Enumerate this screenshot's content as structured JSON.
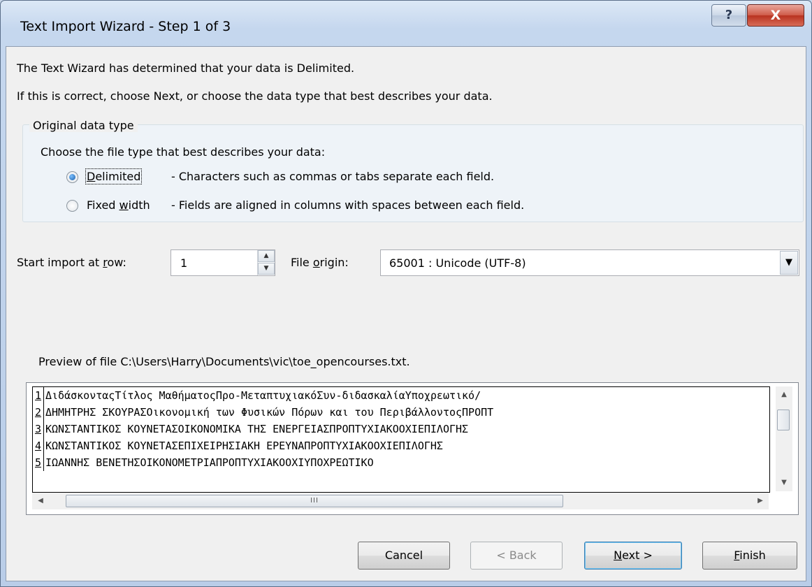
{
  "window": {
    "title": "Text Import Wizard - Step 1 of 3",
    "help_label": "?",
    "close_label": "X"
  },
  "intro": {
    "line1": "The Text Wizard has determined that your data is Delimited.",
    "line2": "If this is correct, choose Next, or choose the data type that best describes your data."
  },
  "data_type": {
    "legend": "Original data type",
    "prompt": "Choose the file type that best describes your data:",
    "options": [
      {
        "label": "Delimited",
        "accel": "D",
        "rest": "elimited",
        "description": "- Characters such as commas or tabs separate each field.",
        "selected": true
      },
      {
        "label": "Fixed width",
        "pre": "Fixed ",
        "accel": "w",
        "rest": "idth",
        "description": "- Fields are aligned in columns with spaces between each field.",
        "selected": false
      }
    ]
  },
  "start_row": {
    "label_pre": "Start import at ",
    "label_accel": "r",
    "label_post": "ow:",
    "value": "1"
  },
  "file_origin": {
    "label_pre": "File ",
    "label_accel": "o",
    "label_post": "rigin:",
    "value": "65001 : Unicode (UTF-8)"
  },
  "preview": {
    "label": "Preview of file C:\\Users\\Harry\\Documents\\vic\\toe_opencourses.txt.",
    "lines": [
      {
        "num": "1",
        "text": "ΔιδάσκονταςΤίτλος ΜαθήματοςΠρο-ΜεταπτυχιακόΣυν-διδασκαλίαΥποχρεωτικό/"
      },
      {
        "num": "2",
        "text": "ΔΗΜΗΤΡΗΣ ΣΚΟΥΡΑΣΟικονομική των Φυσικών Πόρων και του ΠεριβάλλοντοςΠΡΟΠΤ"
      },
      {
        "num": "3",
        "text": "ΚΩΝΣΤΑΝΤΙΚΟΣ ΚΟΥΝΕΤΑΣΟΙΚΟΝΟΜΙΚΑ ΤΗΣ ΕΝΕΡΓΕΙΑΣΠΡΟΠΤΥΧΙΑΚΟΟΧΙΕΠΙΛΟΓΗΣ"
      },
      {
        "num": "4",
        "text": "ΚΩΝΣΤΑΝΤΙΚΟΣ ΚΟΥΝΕΤΑΣΕΠΙΧΕΙΡΗΣΙΑΚΗ ΕΡΕΥΝΑΠΡΟΠΤΥΧΙΑΚΟΟΧΙΕΠΙΛΟΓΗΣ"
      },
      {
        "num": "5",
        "text": "ΙΩΑΝΝΗΣ ΒΕΝΕΤΗΣΟΙΚΟΝΟΜΕΤΡΙΑΠΡΟΠΤΥΧΙΑΚΟΟΧΙΥΠΟΧΡΕΩΤΙΚΟ"
      }
    ],
    "thumb_grip": "III"
  },
  "buttons": {
    "cancel": "Cancel",
    "back": "< Back",
    "next_accel": "N",
    "next_rest": "ext >",
    "finish_accel": "F",
    "finish_rest": "inish"
  },
  "colors": {
    "close_button": "#c9452f",
    "title_gradient": "#c5d7ee",
    "dialog_bg": "#f0f0f0"
  }
}
